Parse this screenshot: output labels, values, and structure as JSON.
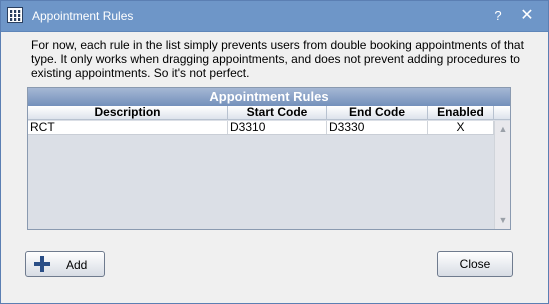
{
  "window": {
    "title": "Appointment Rules",
    "help_label": "?",
    "close_label": "✕"
  },
  "description": "For now, each rule in the list simply prevents users from double booking appointments of that type.  It only works when dragging appointments, and does not prevent adding procedures to existing appointments.  So it's not perfect.",
  "grid": {
    "title": "Appointment Rules",
    "columns": [
      "Description",
      "Start Code",
      "End Code",
      "Enabled"
    ],
    "rows": [
      [
        "RCT",
        "D3310",
        "D3330",
        "X"
      ]
    ],
    "scroll_up": "▲",
    "scroll_down": "▼"
  },
  "buttons": {
    "add_label": "Add",
    "close_label": "Close"
  },
  "colors": {
    "titlebar": "#6e96c8",
    "grid_title": "#7390bb"
  }
}
